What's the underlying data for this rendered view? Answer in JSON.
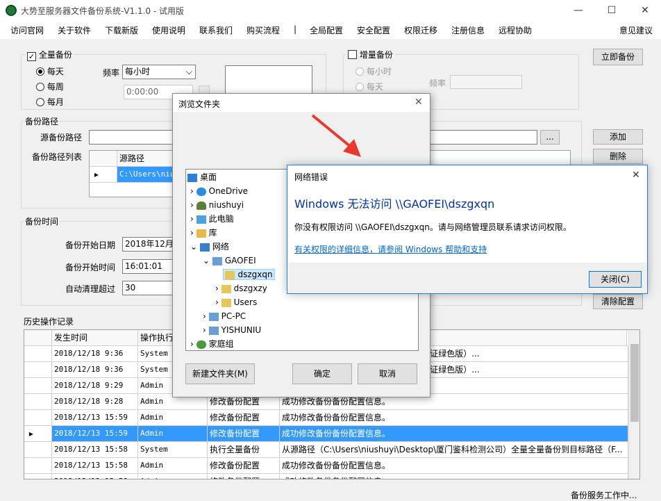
{
  "window": {
    "title": "大势至服务器文件备份系统-V1.1.0 - 试用版",
    "min": "—",
    "max": "☐",
    "close": "✕"
  },
  "menu": {
    "items": [
      "访问官网",
      "关于软件",
      "下载新版",
      "使用说明",
      "联系我们",
      "购买流程",
      "|",
      "全局配置",
      "安全配置",
      "权限迁移",
      "注册信息",
      "远程协助"
    ],
    "right": "意见建议"
  },
  "full_backup": {
    "label": "全量备份",
    "checked": true,
    "daily": "每天",
    "weekly": "每周",
    "monthly": "每月",
    "freq_label": "频率",
    "freq_value": "每小时",
    "time_value": "0:00:00"
  },
  "inc_backup": {
    "label": "增量备份",
    "hourly": "每小时",
    "daily": "每天",
    "freq_label": "频率"
  },
  "backup_now": "立即备份",
  "paths": {
    "section": "备份路径",
    "source_label": "源备份路径",
    "browse": "...",
    "list_label": "备份路径列表",
    "col_source": "源路径",
    "row1": "C:\\Users\\niush",
    "add": "添加",
    "delete": "删除"
  },
  "times": {
    "section": "备份时间",
    "start_date_label": "备份开始日期",
    "start_date": "2018年12月13",
    "start_time_label": "备份开始时间",
    "start_time": "16:01:01",
    "auto_clean_label": "自动清理超过",
    "auto_clean": "30",
    "clear_config": "清除配置"
  },
  "history": {
    "section": "历史操作记录",
    "col_time": "发生时间",
    "col_exec": "操作执行",
    "rows": [
      {
        "time": "2018/12/18 9:36",
        "user": "System",
        "action": "",
        "detail": "TeamViewer 7.0.12541 已激活带许可证绿色版）..."
      },
      {
        "time": "2018/12/18 9:36",
        "user": "System",
        "action": "",
        "detail": "TeamViewer 7.0.12541 已激活带许可证绿色版）..."
      },
      {
        "time": "2018/12/18 9:29",
        "user": "Admin",
        "action": "",
        "detail": ""
      },
      {
        "time": "2018/12/18 9:28",
        "user": "Admin",
        "action": "修改备份配置",
        "detail": "成功修改备份备份配置信息。"
      },
      {
        "time": "2018/12/13 15:59",
        "user": "Admin",
        "action": "修改备份配置",
        "detail": "成功修改备份备份配置信息。"
      },
      {
        "time": "2018/12/13 15:59",
        "user": "Admin",
        "action": "修改备份配置",
        "detail": "成功修改备份备份配置信息。"
      },
      {
        "time": "2018/12/13 15:58",
        "user": "System",
        "action": "执行全量备份",
        "detail": "从源路径（C:\\Users\\niushuyi\\Desktop\\厦门鉴科检测公司）全量全量备份到目标路径（F..."
      },
      {
        "time": "2018/12/13 15:58",
        "user": "Admin",
        "action": "修改备份配置",
        "detail": "成功修改备份备份配置信息。"
      },
      {
        "time": "2018/12/13 15:58",
        "user": "Admin",
        "action": "修改备份配置",
        "detail": "成功修改备份备份配置信息。"
      }
    ]
  },
  "status": "备份服务工作中...",
  "browse_dialog": {
    "title": "浏览文件夹",
    "close": "✕",
    "tree": [
      "桌面",
      "OneDrive",
      "niushuyi",
      "此电脑",
      "库",
      "网络",
      "GAOFEI",
      "dszgxqn",
      "dszgxzy",
      "Users",
      "PC-PC",
      "YISHUNIU",
      "家庭组"
    ],
    "new_folder": "新建文件夹(M)",
    "ok": "确定",
    "cancel": "取消"
  },
  "error_dialog": {
    "title": "网络错误",
    "close": "✕",
    "heading": "Windows 无法访问 \\\\GAOFEI\\dszgxqn",
    "message": "你没有权限访问 \\\\GAOFEI\\dszgxqn。请与网络管理员联系请求访问权限。",
    "link": "有关权限的详细信息，请参阅 Windows 帮助和支持",
    "close_btn": "关闭(C)"
  },
  "colors": {
    "selection": "#3399ff",
    "link": "#0066cc",
    "heading": "#003399",
    "arrow": "#e8392f"
  }
}
